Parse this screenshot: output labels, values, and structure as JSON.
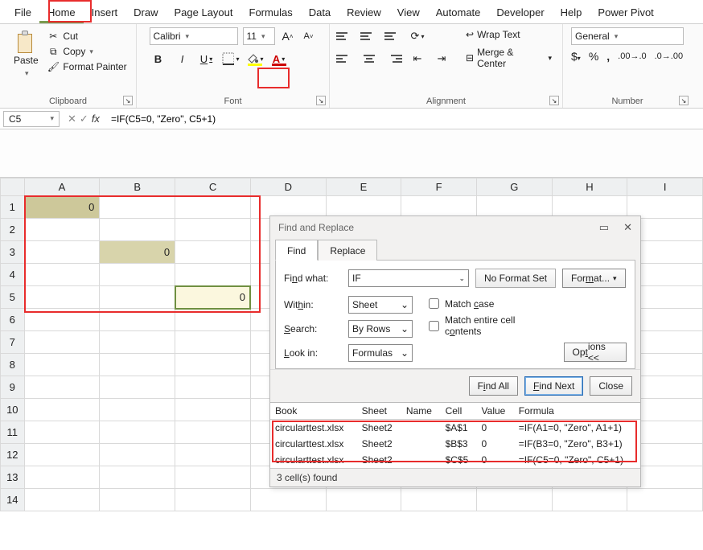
{
  "menu": {
    "items": [
      "File",
      "Home",
      "Insert",
      "Draw",
      "Page Layout",
      "Formulas",
      "Data",
      "Review",
      "View",
      "Automate",
      "Developer",
      "Help",
      "Power Pivot"
    ],
    "active_index": 1
  },
  "ribbon": {
    "clipboard": {
      "label": "Clipboard",
      "paste": "Paste",
      "cut": "Cut",
      "copy": "Copy",
      "format_painter": "Format Painter"
    },
    "font": {
      "label": "Font",
      "name": "Calibri",
      "size": "11",
      "bold": "B",
      "italic": "I",
      "underline": "U"
    },
    "alignment": {
      "label": "Alignment",
      "wrap": "Wrap Text",
      "merge": "Merge & Center"
    },
    "number": {
      "label": "Number",
      "format": "General"
    }
  },
  "namebox": "C5",
  "formula": "=IF(C5=0, \"Zero\", C5+1)",
  "grid": {
    "columns": [
      "A",
      "B",
      "C",
      "D",
      "E",
      "F",
      "G",
      "H",
      "I"
    ],
    "rows": 14,
    "cells": {
      "A1": "0",
      "B3": "0",
      "C5": "0"
    }
  },
  "dialog": {
    "title": "Find and Replace",
    "tabs": {
      "find": "Find",
      "replace": "Replace"
    },
    "find_what_label": "Find what:",
    "find_what_value": "IF",
    "no_format": "No Format Set",
    "format_btn": "Format...",
    "within_label": "Within:",
    "within_value": "Sheet",
    "search_label": "Search:",
    "search_value": "By Rows",
    "lookin_label": "Look in:",
    "lookin_value": "Formulas",
    "match_case": "Match case",
    "match_entire": "Match entire cell contents",
    "options": "Options <<",
    "find_all": "Find All",
    "find_next": "Find Next",
    "close": "Close",
    "results": {
      "headers": [
        "Book",
        "Sheet",
        "Name",
        "Cell",
        "Value",
        "Formula"
      ],
      "rows": [
        {
          "book": "circularttest.xlsx",
          "sheet": "Sheet2",
          "name": "",
          "cell": "$A$1",
          "value": "0",
          "formula": "=IF(A1=0, \"Zero\", A1+1)"
        },
        {
          "book": "circularttest.xlsx",
          "sheet": "Sheet2",
          "name": "",
          "cell": "$B$3",
          "value": "0",
          "formula": "=IF(B3=0, \"Zero\", B3+1)"
        },
        {
          "book": "circularttest.xlsx",
          "sheet": "Sheet2",
          "name": "",
          "cell": "$C$5",
          "value": "0",
          "formula": "=IF(C5=0, \"Zero\", C5+1)"
        }
      ]
    },
    "status": "3 cell(s) found"
  }
}
